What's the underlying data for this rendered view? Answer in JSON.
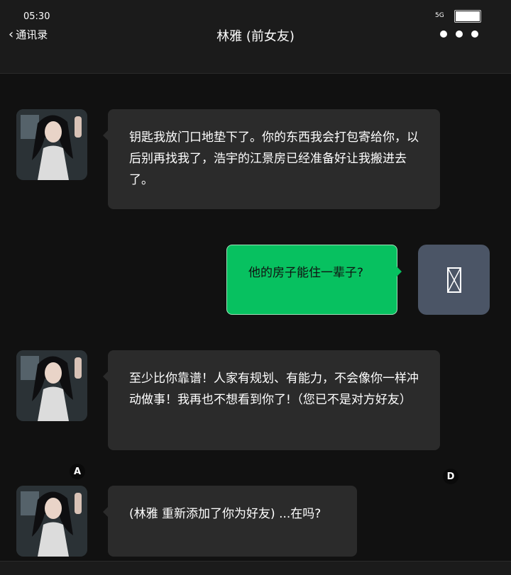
{
  "status_bar": {
    "time": "05:30",
    "network": "5G",
    "battery_level": 1.0
  },
  "header": {
    "back_label": "通讯录",
    "title": "林雅 (前女友)",
    "more_icon": "more-dots-icon"
  },
  "messages": [
    {
      "side": "left",
      "text": "钥匙我放门口地垫下了。你的东西我会打包寄给你，以后别再找我了，浩宇的江景房已经准备好让我搬进去了。"
    },
    {
      "side": "right",
      "text": "他的房子能住一辈子?"
    },
    {
      "side": "left",
      "text": "至少比你靠谱！人家有规划、有能力，不会像你一样冲动做事！我再也不想看到你了!（您已不是对方好友）"
    },
    {
      "side": "left",
      "text": "(林雅 重新添加了你为好友) ...在吗?"
    }
  ],
  "markers": [
    "A",
    "D"
  ],
  "colors": {
    "outgoing_bubble": "#07c160",
    "incoming_bubble": "#2b2b2b",
    "background": "#111111"
  }
}
